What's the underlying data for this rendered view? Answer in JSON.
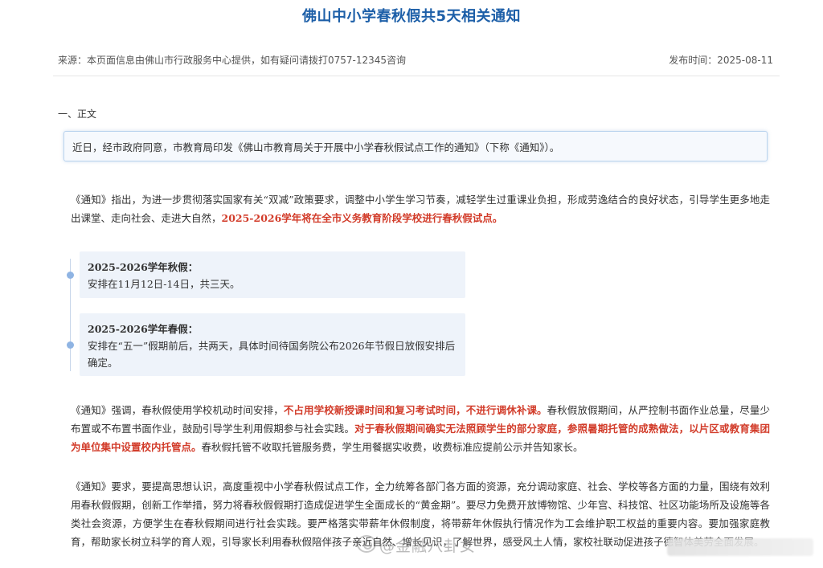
{
  "header": {
    "title": "佛山中小学春秋假共5天相关通知",
    "source": "来源：本页面信息由佛山市行政服务中心提供，如有疑问请拨打0757-12345咨询",
    "date": "发布时间：2025-08-11"
  },
  "section": {
    "heading": "一、正文"
  },
  "intro": "近日，经市政府同意，市教育局印发《佛山市教育局关于开展中小学春秋假试点工作的通知》（下称《通知》）。",
  "p1": {
    "text": "《通知》指出，为进一步贯彻落实国家有关“双减”政策要求，调整中小学生学习节奏，减轻学生过重课业负担，形成劳逸结合的良好状态，引导学生更多地走出课堂、走向社会、走进大自然，",
    "highlight": "2025-2026学年将在全市义务教育阶段学校进行春秋假试点。"
  },
  "timeline": {
    "autumn_label": "2025-2026学年秋假：",
    "autumn_text": "安排在11月12日-14日，共三天。",
    "spring_label": "2025-2026学年春假：",
    "spring_text": "安排在“五一”假期前后，共两天，具体时间待国务院公布2026年节假日放假安排后确定。"
  },
  "p2": {
    "a": "《通知》强调，春秋假使用学校机动时间安排，",
    "b": "不占用学校新授课时间和复习考试时间，不进行调休补课。",
    "c": "春秋假放假期间，从严控制书面作业总量，尽量少布置或不布置书面作业，鼓励引导学生利用假期参与社会实践。",
    "d": "对于春秋假期间确实无法照顾学生的部分家庭，参照暑期托管的成熟做法，以片区或教育集团为单位集中设置校内托管点。",
    "e": "春秋假托管不收取托管服务费，学生用餐据实收费，收费标准应提前公示并告知家长。"
  },
  "p3": {
    "text": "《通知》要求，要提高思想认识，高度重视中小学春秋假试点工作，全力统筹各部门各方面的资源，充分调动家庭、社会、学校等各方面的力量，围绕有效利用春秋假假期，创新工作举措，努力将春秋假假期打造成促进学生全面成长的“黄金期”。要尽力免费开放博物馆、少年宫、科技馆、社区功能场所及设施等各类社会资源，方便学生在春秋假期间进行社会实践。要严格落实带薪年休假制度，将带薪年休假执行情况作为工会维护职工权益的重要内容。要加强家庭教育，帮助家长树立科学的育人观，引导家长利用春秋假陪伴孩子亲近自然、增长见识，了解世界，感受风土人情，家校社联动促进孩子德智体美劳全面发展。"
  },
  "watermark": "@金融八卦女"
}
